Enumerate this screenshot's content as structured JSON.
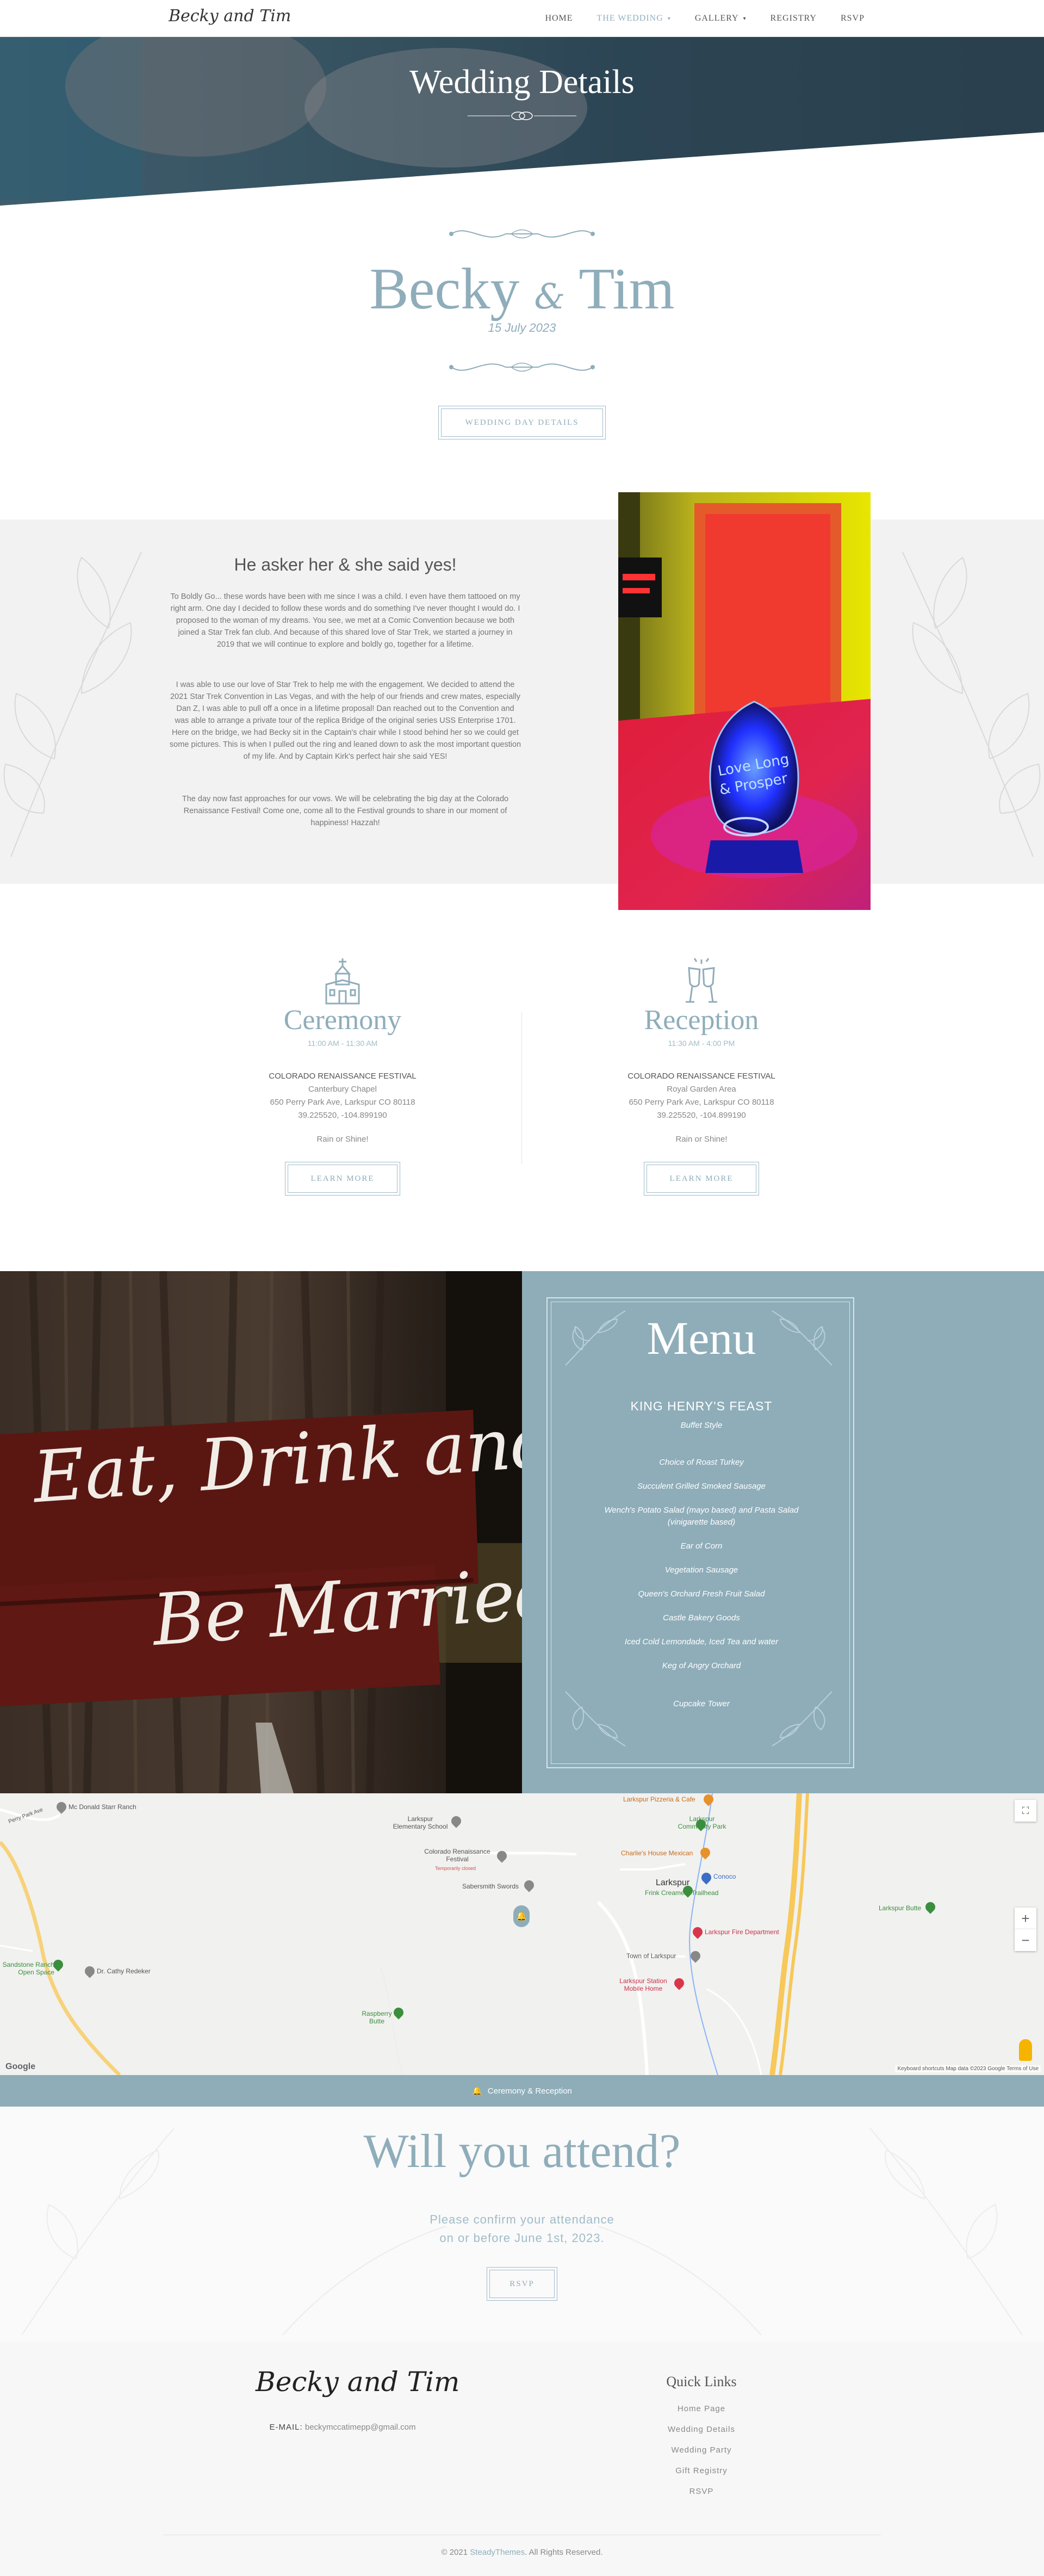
{
  "nav": {
    "logo_text": "Becky and Tim",
    "items": [
      {
        "label": "Home",
        "active": false,
        "dropdown": false
      },
      {
        "label": "The Wedding",
        "active": true,
        "dropdown": true
      },
      {
        "label": "Gallery",
        "active": false,
        "dropdown": true
      },
      {
        "label": "Registry",
        "active": false,
        "dropdown": false
      },
      {
        "label": "RSVP",
        "active": false,
        "dropdown": false
      }
    ]
  },
  "hero": {
    "title": "Wedding Details"
  },
  "couple": {
    "name_first": "Becky",
    "amp": "&",
    "name_second": "Tim",
    "date": "15 July 2023",
    "button_label": "Wedding Day Details"
  },
  "story": {
    "title": "He asker her & she said yes!",
    "paragraphs": [
      "To Boldly Go... these words have been with me since I was a child. I even have them tattooed on my right arm. One day I decided to follow these words and do something I've never thought I would do. I proposed to the woman of my dreams. You see, we met at a Comic Convention because we both joined a Star Trek fan club. And because of this shared love of Star Trek, we started a journey in 2019 that we will continue to explore and boldly go, together for a lifetime.",
      "I was able to use our love of Star Trek to help me with the engagement. We decided to attend the 2021 Star Trek Convention in Las Vegas, and with the help of our friends and crew mates, especially Dan Z, I was able to pull off a once in a lifetime proposal! Dan reached out to the Convention and was able to arrange a private tour of the replica Bridge of the original series USS Enterprise 1701. Here on the bridge, we had Becky sit in the Captain's chair while I stood behind her so we could get some pictures. This is when I pulled out the ring and leaned down to ask the most important question of my life. And by Captain Kirk's perfect hair she said YES!",
      "The day now fast approaches for our vows. We will be celebrating the big day at the Colorado Renaissance Festival! Come one, come all to the Festival grounds to share in our moment of happiness! Hazzah!"
    ],
    "photo_caption": "Love Long & Prosper"
  },
  "events": [
    {
      "icon": "chapel-icon",
      "title": "Ceremony",
      "time": "11:00 AM - 11:30 AM",
      "venue": "COLORADO RENAISSANCE FESTIVAL",
      "location": "Canterbury Chapel",
      "address": "650 Perry Park Ave, Larkspur CO 80118",
      "coords": "39.225520, -104.899190",
      "note": "Rain or Shine!",
      "button_label": "Learn More"
    },
    {
      "icon": "champagne-glasses-icon",
      "title": "Reception",
      "time": "11:30 AM - 4:00 PM",
      "venue": "COLORADO RENAISSANCE FESTIVAL",
      "location": "Royal Garden Area",
      "address": "650 Perry Park Ave, Larkspur CO 80118",
      "coords": "39.225520, -104.899190",
      "note": "Rain or Shine!",
      "button_label": "Learn More"
    }
  ],
  "sign_photo": {
    "line1": "Eat, Drink and",
    "line2": "Be Married"
  },
  "menu": {
    "title": "Menu",
    "feast": "KING HENRY'S FEAST",
    "style": "Buffet Style",
    "items": [
      "Choice of Roast Turkey",
      "Succulent Grilled Smoked Sausage",
      "Wench's Potato Salad (mayo based) and Pasta Salad (vinigarette based)",
      "Ear of Corn",
      "Vegetation Sausage",
      "Queen's Orchard Fresh Fruit Salad",
      "Castle Bakery Goods",
      "Iced Cold Lemondade, Iced Tea and water",
      "Keg of Angry Orchard",
      "Cupcake Tower"
    ]
  },
  "map": {
    "labels": [
      {
        "text": "Mc Donald Starr Ranch",
        "kind": "gray"
      },
      {
        "text": "Larkspur Elementary School",
        "kind": "gray"
      },
      {
        "text": "Colorado Renaissance Festival",
        "kind": "gray"
      },
      {
        "text": "Temporarily closed",
        "kind": "gray"
      },
      {
        "text": "Sabersmith Swords",
        "kind": "gray"
      },
      {
        "text": "Larkspur Pizzeria & Cafe",
        "kind": "orange"
      },
      {
        "text": "Larkspur Community Park",
        "kind": "green"
      },
      {
        "text": "Charlie's House Mexican",
        "kind": "orange"
      },
      {
        "text": "Conoco",
        "kind": "blue"
      },
      {
        "text": "Larkspur",
        "kind": "gray"
      },
      {
        "text": "Frink Creamery Trailhead",
        "kind": "green"
      },
      {
        "text": "Larkspur Fire Department",
        "kind": "red"
      },
      {
        "text": "Town of Larkspur",
        "kind": "gray"
      },
      {
        "text": "Larkspur Station Mobile Home",
        "kind": "red"
      },
      {
        "text": "Larkspur Butte",
        "kind": "green"
      },
      {
        "text": "Raspberry Butte",
        "kind": "green"
      },
      {
        "text": "Dr. Cathy Redeker",
        "kind": "gray"
      },
      {
        "text": "Sandstone Ranch Open Space",
        "kind": "green"
      },
      {
        "text": "Perry Park Ave",
        "kind": "gray"
      }
    ],
    "google": "Google",
    "attribution": "Keyboard shortcuts   Map data ©2023 Google   Terms of Use",
    "zoom_in": "+",
    "zoom_out": "−",
    "bar_label": "Ceremony & Reception"
  },
  "rsvp": {
    "title": "Will you attend?",
    "line1": "Please confirm your attendance",
    "line2": "on or before June 1st, 2023.",
    "button_label": "RSVP"
  },
  "footer": {
    "logo_text": "Becky and Tim",
    "email_label": "E-MAIL:",
    "email_value": "beckymccatimepp@gmail.com",
    "quick_links_title": "Quick Links",
    "links": [
      "Home Page",
      "Wedding Details",
      "Wedding Party",
      "Gift Registry",
      "RSVP"
    ],
    "copyright_prefix": "© 2021",
    "copyright_brand": "SteadyThemes",
    "copyright_suffix": ". All Rights Reserved."
  },
  "colors": {
    "accent": "#8fadba",
    "menu_panel": "#8eadb9",
    "hero_dark": "#2f4756"
  }
}
